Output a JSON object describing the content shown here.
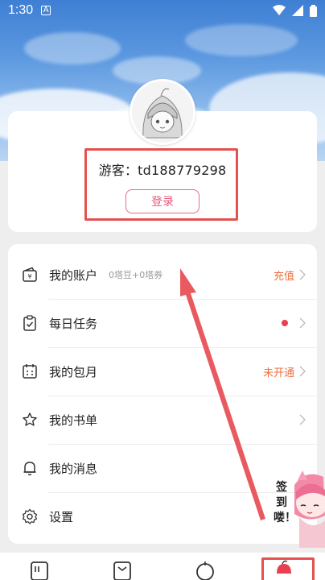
{
  "status_bar": {
    "time": "1:30",
    "a_icon": "A"
  },
  "profile": {
    "guest_label": "游客：td188779298",
    "login_label": "登录"
  },
  "menu": [
    {
      "icon": "wallet-icon",
      "label": "我的账户",
      "sub": "0塔豆+0塔券",
      "right": "充值"
    },
    {
      "icon": "clipboard-check-icon",
      "label": "每日任务",
      "sub": "",
      "right": ""
    },
    {
      "icon": "calendar-icon",
      "label": "我的包月",
      "sub": "",
      "right": "未开通"
    },
    {
      "icon": "star-icon",
      "label": "我的书单",
      "sub": "",
      "right": ""
    },
    {
      "icon": "bell-icon",
      "label": "我的消息",
      "sub": "",
      "right": ""
    },
    {
      "icon": "gear-icon",
      "label": "设置",
      "sub": "",
      "right": ""
    }
  ],
  "checkin": {
    "text": "签到喽！"
  },
  "colors": {
    "accent_pink": "#e55b7d",
    "accent_orange": "#ef6e3c",
    "highlight_red": "#e4514f"
  }
}
